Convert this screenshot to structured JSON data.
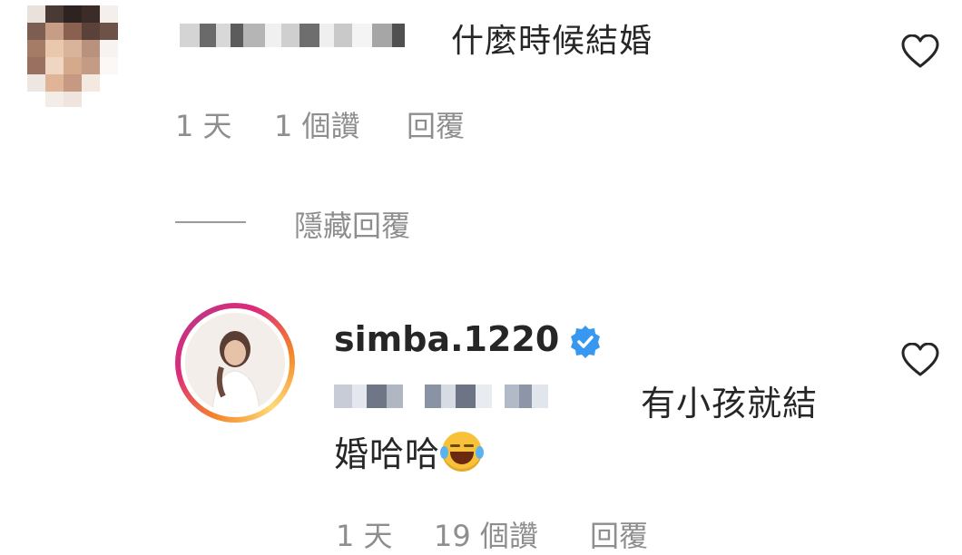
{
  "comments": [
    {
      "text": "什麼時候結婚",
      "time": "1 天",
      "likes": "1 個讚",
      "reply": "回覆"
    }
  ],
  "hide_replies": "隱藏回覆",
  "reply_comment": {
    "username": "simba.1220",
    "text_line1": "有小孩就結",
    "text_line2": "婚哈哈",
    "time": "1 天",
    "likes": "19 個讚",
    "reply": "回覆"
  },
  "icons": {
    "like": "heart-outline-icon",
    "verified": "verified-badge-icon",
    "emoji": "tears-of-joy-emoji"
  },
  "colors": {
    "verified_blue": "#3897f0",
    "meta_gray": "#8e8e8e",
    "story_ring": "#dd2a7b"
  }
}
